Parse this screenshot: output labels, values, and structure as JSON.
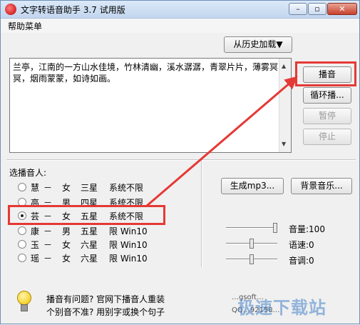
{
  "window": {
    "title": "文字转语音助手 3.7 试用版",
    "controls": {
      "minimize": "–",
      "maximize": "▫",
      "close": "✕"
    }
  },
  "menu": {
    "help": "帮助菜单"
  },
  "history_button": "从历史加载▼",
  "text_content": "兰亭，江南的一方山水佳境，竹林清幽，溪水潺潺，青翠片片，薄雾冥冥，烟雨蒙蒙，如诗如画。",
  "scrollbar": {
    "up": "▲",
    "down": "▼"
  },
  "buttons": {
    "play": "播音",
    "loop_play": "循环播...",
    "pause": "暂停",
    "stop": "停止",
    "generate_mp3": "生成mp3...",
    "bg_music": "背景音乐..."
  },
  "voice_section": {
    "label": "选播音人:",
    "voices": [
      {
        "name": "慧",
        "dash": "－",
        "gender": "女",
        "stars": "三星",
        "limit": "系统不限",
        "checked": false
      },
      {
        "name": "高",
        "dash": "－",
        "gender": "男",
        "stars": "四星",
        "limit": "系统不限",
        "checked": false
      },
      {
        "name": "芸",
        "dash": "－",
        "gender": "女",
        "stars": "五星",
        "limit": "系统不限",
        "checked": true
      },
      {
        "name": "康",
        "dash": "－",
        "gender": "男",
        "stars": "五星",
        "limit": "限 Win10",
        "checked": false
      },
      {
        "name": "玉",
        "dash": "－",
        "gender": "女",
        "stars": "六星",
        "limit": "限 Win10",
        "checked": false
      },
      {
        "name": "瑶",
        "dash": "－",
        "gender": "女",
        "stars": "六星",
        "limit": "限 Win10",
        "checked": false
      }
    ]
  },
  "sliders": {
    "volume": {
      "label": "音量:100",
      "value": 100,
      "min": 0,
      "max": 100
    },
    "speed": {
      "label": "语速:0",
      "value": 0,
      "min": -10,
      "max": 10
    },
    "pitch": {
      "label": "音调:0",
      "value": 0,
      "min": -10,
      "max": 10
    }
  },
  "help_text": {
    "line1": "播音有问题? 官网下播音人重装",
    "line2": "个别音不准? 用别字或换个句子"
  },
  "contact": {
    "line1": "…gsoft…",
    "line2": "QQ…92158…"
  },
  "watermark": "极速下载站",
  "colors": {
    "highlight": "#e53935",
    "arrow": "#e53935",
    "title_gradient_top": "#dbe8f8"
  }
}
